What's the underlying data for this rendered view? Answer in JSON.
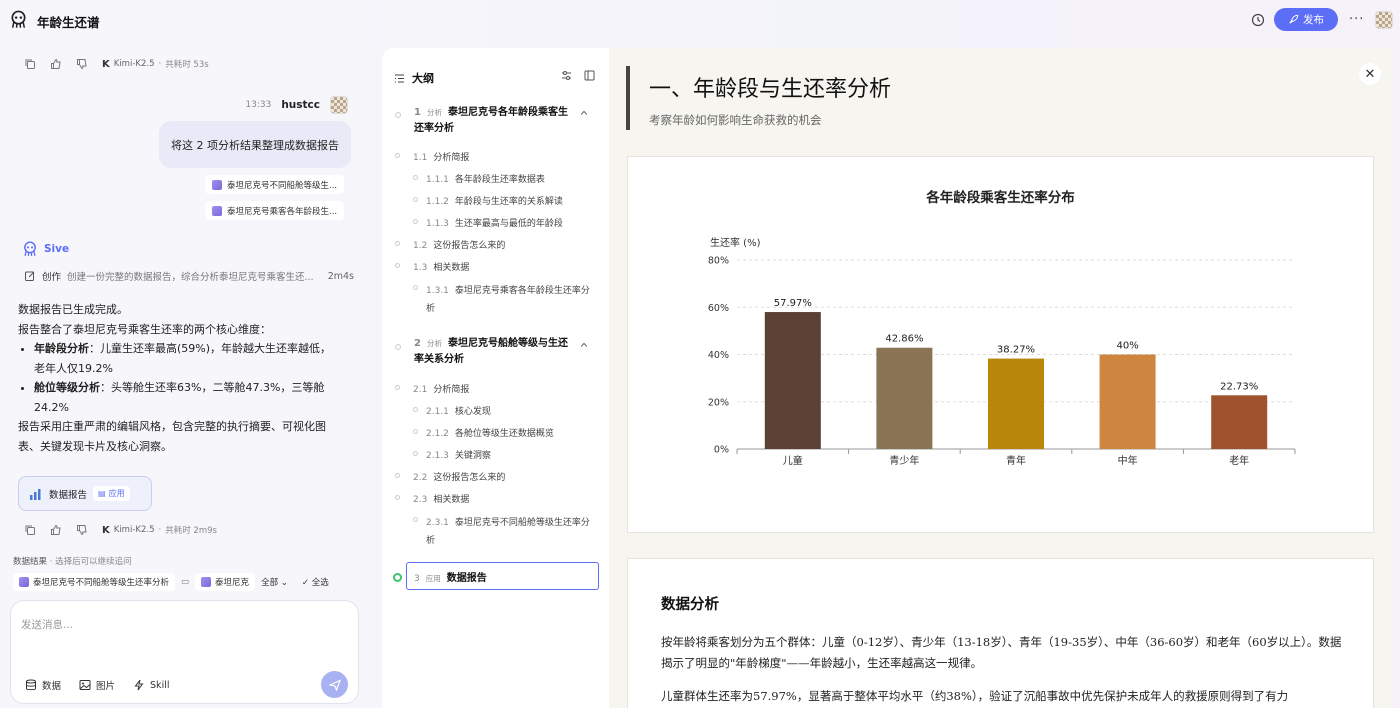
{
  "app": {
    "title": "年龄生还谱",
    "publish_label": "发布"
  },
  "chat": {
    "top_meta": {
      "model": "Kimi-K2.5",
      "duration": "共耗时 53s"
    },
    "user_msg": {
      "time": "13:33",
      "name": "hustcc",
      "text": "将这 2 项分析结果整理成数据报告"
    },
    "attachments": [
      "泰坦尼克号不同船舱等级生...",
      "泰坦尼克号乘客各年龄段生..."
    ],
    "agent_name": "Sive",
    "create": {
      "label": "创作",
      "desc": "创建一份完整的数据报告，综合分析泰坦尼克号乘客生还...",
      "duration": "2m4s"
    },
    "summary": {
      "p1": "数据报告已生成完成。",
      "p2": "报告整合了泰坦尼克号乘客生还率的两个核心维度：",
      "b1_label": "年龄段分析",
      "b1_text": "：儿童生还率最高(59%)，年龄越大生还率越低，老年人仅19.2%",
      "b2_label": "舱位等级分析",
      "b2_text": "：头等舱生还率63%，二等舱47.3%，三等舱24.2%",
      "p3": "报告采用庄重严肃的编辑风格，包含完整的执行摘要、可视化图表、关键发现卡片及核心洞察。"
    },
    "report_card": {
      "title": "数据报告",
      "apply": "应用"
    },
    "bottom_meta": {
      "model": "Kimi-K2.5",
      "duration": "共耗时 2m9s"
    },
    "results": {
      "title": "数据结果",
      "hint": "选择后可以继续追问",
      "chip1": "泰坦尼克号不同船舱等级生还率分析",
      "chip2": "泰坦尼克",
      "all": "全部",
      "select_all": "全选"
    },
    "input": {
      "placeholder": "发送消息...",
      "tool_data": "数据",
      "tool_image": "图片",
      "tool_skill": "Skill"
    }
  },
  "outline": {
    "title": "大纲",
    "sec1": {
      "num": "1",
      "tag": "分析",
      "title": "泰坦尼克号各年龄段乘客生还率分析"
    },
    "sec1_items": [
      {
        "num": "1.1",
        "text": "分析简报"
      },
      {
        "num": "1.1.1",
        "text": "各年龄段生还率数据表"
      },
      {
        "num": "1.1.2",
        "text": "年龄段与生还率的关系解读"
      },
      {
        "num": "1.1.3",
        "text": "生还率最高与最低的年龄段"
      },
      {
        "num": "1.2",
        "text": "这份报告怎么来的"
      },
      {
        "num": "1.3",
        "text": "相关数据"
      },
      {
        "num": "1.3.1",
        "text": "泰坦尼克号乘客各年龄段生还率分",
        "text2": "析"
      }
    ],
    "sec2": {
      "num": "2",
      "tag": "分析",
      "title": "泰坦尼克号船舱等级与生还率关系分析"
    },
    "sec2_items": [
      {
        "num": "2.1",
        "text": "分析简报"
      },
      {
        "num": "2.1.1",
        "text": "核心发现"
      },
      {
        "num": "2.1.2",
        "text": "各舱位等级生还数据概览"
      },
      {
        "num": "2.1.3",
        "text": "关键洞察"
      },
      {
        "num": "2.2",
        "text": "这份报告怎么来的"
      },
      {
        "num": "2.3",
        "text": "相关数据"
      },
      {
        "num": "2.3.1",
        "text": "泰坦尼克号不同船舱等级生还率分",
        "text2": "析"
      }
    ],
    "sec3": {
      "num": "3",
      "tag": "应用",
      "title": "数据报告"
    }
  },
  "doc": {
    "title": "一、年龄段与生还率分析",
    "subtitle": "考察年龄如何影响生命获救的机会",
    "analysis_title": "数据分析",
    "para1": "按年龄将乘客划分为五个群体：儿童（0-12岁）、青少年（13-18岁）、青年（19-35岁）、中年（36-60岁）和老年（60岁以上）。数据揭示了明显的\"年龄梯度\"——年龄越小，生还率越高这一规律。",
    "para2": "儿童群体生还率为57.97%，显著高于整体平均水平（约38%），验证了沉船事故中优先保护未成年人的救援原则得到了有力"
  },
  "chart_data": {
    "type": "bar",
    "title": "各年龄段乘客生还率分布",
    "ylabel": "生还率 (%)",
    "categories": [
      "儿童",
      "青少年",
      "青年",
      "中年",
      "老年"
    ],
    "values": [
      57.97,
      42.86,
      38.27,
      40,
      22.73
    ],
    "labels": [
      "57.97%",
      "42.86%",
      "38.27%",
      "40%",
      "22.73%"
    ],
    "colors": [
      "#5c4033",
      "#8b7355",
      "#b8860b",
      "#cd853f",
      "#a0522d"
    ],
    "ylim": [
      0,
      80
    ],
    "yticks": [
      0,
      20,
      40,
      60,
      80
    ],
    "ytick_labels": [
      "0%",
      "20%",
      "40%",
      "60%",
      "80%"
    ],
    "grid": true
  }
}
